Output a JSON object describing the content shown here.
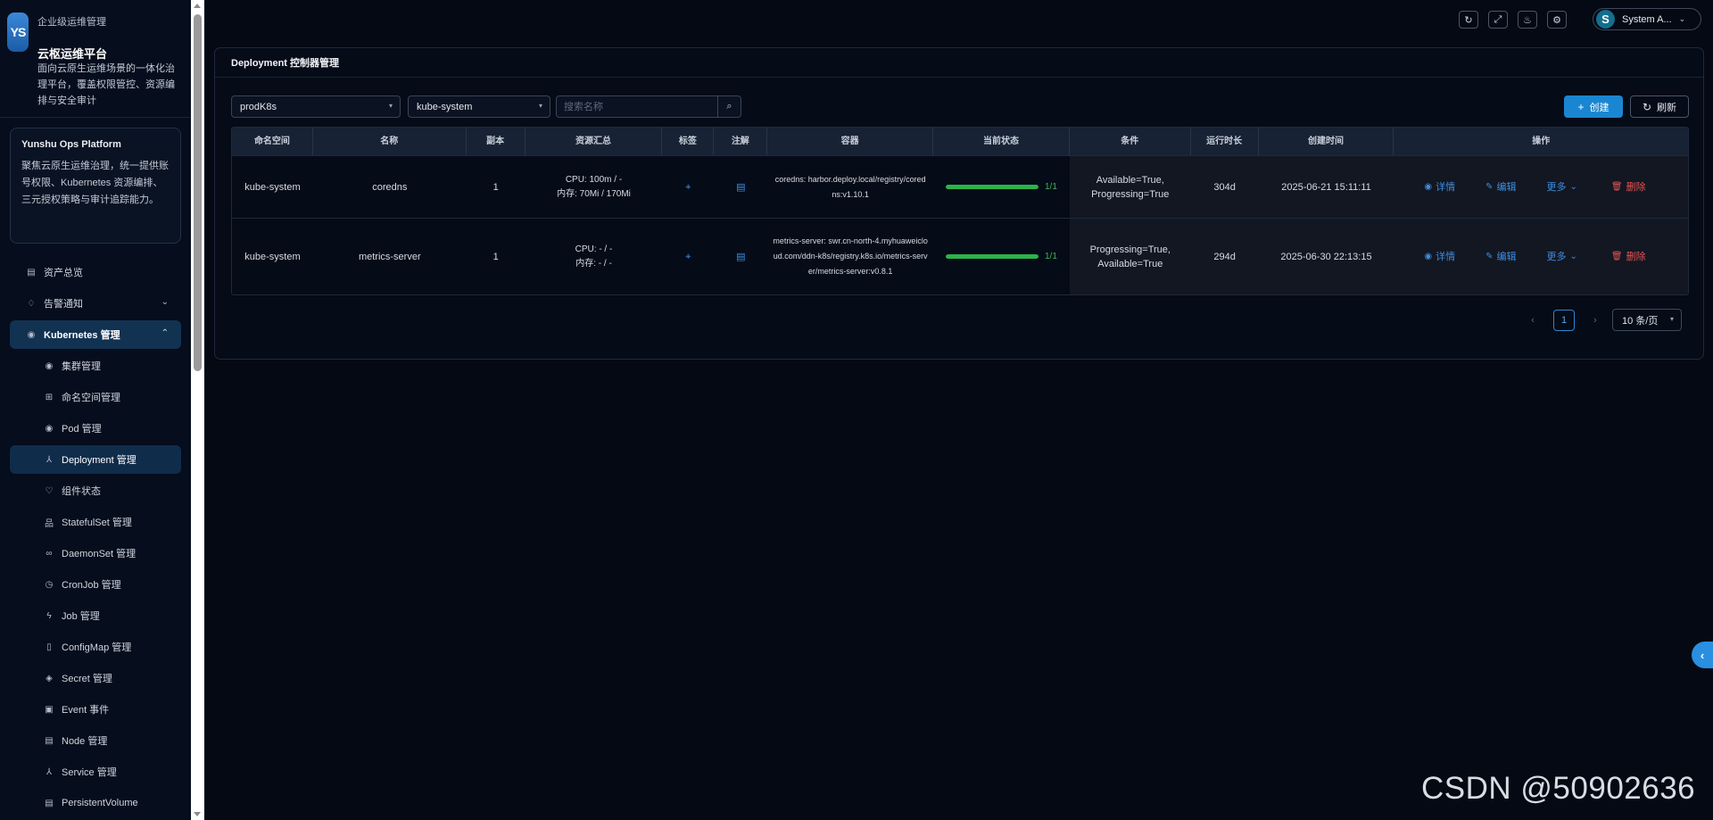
{
  "brand": {
    "logo": "YS",
    "kicker": "企业级运维管理",
    "title": "云枢运维平台",
    "description": "面向云原生运维场景的一体化治理平台，覆盖权限管控、资源编排与安全审计"
  },
  "intro": {
    "title": "Yunshu Ops Platform",
    "description": "聚焦云原生运维治理，统一提供账号权限、Kubernetes 资源编排、三元授权策略与审计追踪能力。"
  },
  "nav": [
    {
      "label": "资产总览",
      "icon": "document-icon",
      "glyph": "▤"
    },
    {
      "label": "告警通知",
      "icon": "bell-icon",
      "glyph": "♢",
      "chevron": "⌄"
    },
    {
      "label": "Kubernetes 管理",
      "icon": "kubernetes-icon",
      "glyph": "◉",
      "chevron": "⌃"
    },
    {
      "label": "集群管理",
      "icon": "cluster-icon",
      "glyph": "◉"
    },
    {
      "label": "命名空间管理",
      "icon": "grid-icon",
      "glyph": "⊞"
    },
    {
      "label": "Pod 管理",
      "icon": "pod-icon",
      "glyph": "◉"
    },
    {
      "label": "Deployment 管理",
      "icon": "deployment-icon",
      "glyph": "⅄"
    },
    {
      "label": "组件状态",
      "icon": "heart-icon",
      "glyph": "♡"
    },
    {
      "label": "StatefulSet 管理",
      "icon": "statefulset-icon",
      "glyph": "品"
    },
    {
      "label": "DaemonSet 管理",
      "icon": "link-icon",
      "glyph": "∞"
    },
    {
      "label": "CronJob 管理",
      "icon": "clock-icon",
      "glyph": "◷"
    },
    {
      "label": "Job 管理",
      "icon": "bolt-icon",
      "glyph": "ϟ"
    },
    {
      "label": "ConfigMap 管理",
      "icon": "file-icon",
      "glyph": "▯"
    },
    {
      "label": "Secret 管理",
      "icon": "shield-icon",
      "glyph": "◈"
    },
    {
      "label": "Event 事件",
      "icon": "event-icon",
      "glyph": "▣"
    },
    {
      "label": "Node 管理",
      "icon": "node-icon",
      "glyph": "▤"
    },
    {
      "label": "Service 管理",
      "icon": "service-icon",
      "glyph": "⅄"
    },
    {
      "label": "PersistentVolume",
      "icon": "volume-icon",
      "glyph": "▤"
    }
  ],
  "topbar": {
    "icons": [
      {
        "name": "refresh-icon",
        "glyph": "↻"
      },
      {
        "name": "fullscreen-icon",
        "glyph": "⤢"
      },
      {
        "name": "bulb-icon",
        "glyph": "♨"
      },
      {
        "name": "settings-icon",
        "glyph": "⚙"
      }
    ],
    "user": {
      "avatar": "S",
      "name": "System A...",
      "chevron": "⌄"
    }
  },
  "panel": {
    "title": "Deployment 控制器管理",
    "cluster_select": "prodK8s",
    "namespace_select": "kube-system",
    "search_placeholder": "搜索名称",
    "create_label": "创建",
    "refresh_label": "刷新"
  },
  "table": {
    "headers": [
      "命名空间",
      "名称",
      "副本",
      "资源汇总",
      "标签",
      "注解",
      "容器",
      "当前状态",
      "条件",
      "运行时长",
      "创建时间",
      "操作"
    ],
    "rows": [
      {
        "namespace": "kube-system",
        "name": "coredns",
        "replicas": "1",
        "res_cpu": "CPU: 100m / -",
        "res_mem": "内存: 70Mi / 170Mi",
        "image": "coredns: harbor.deploy.local/registry/coredns:v1.10.1",
        "ready_fraction": 1.0,
        "status": "1/1",
        "conditions": "Available=True, Progressing=True",
        "age": "304d",
        "created": "2025-06-21 15:11:11"
      },
      {
        "namespace": "kube-system",
        "name": "metrics-server",
        "replicas": "1",
        "res_cpu": "CPU: - / -",
        "res_mem": "内存: - / -",
        "image": "metrics-server: swr.cn-north-4.myhuaweicloud.com/ddn-k8s/registry.k8s.io/metrics-server/metrics-server:v0.8.1",
        "ready_fraction": 1.0,
        "status": "1/1",
        "conditions": "Progressing=True, Available=True",
        "age": "294d",
        "created": "2025-06-30 22:13:15"
      }
    ],
    "ops": {
      "detail": "详情",
      "edit": "编辑",
      "more": "更多",
      "delete": "删除"
    }
  },
  "pagination": {
    "prev": "‹",
    "current": "1",
    "next": "›",
    "page_size": "10 条/页"
  },
  "watermark": "CSDN @50902636",
  "colors": {
    "accent": "#1a86d1",
    "success": "#2bb34a",
    "danger": "#e55353",
    "link": "#3e8de0"
  }
}
